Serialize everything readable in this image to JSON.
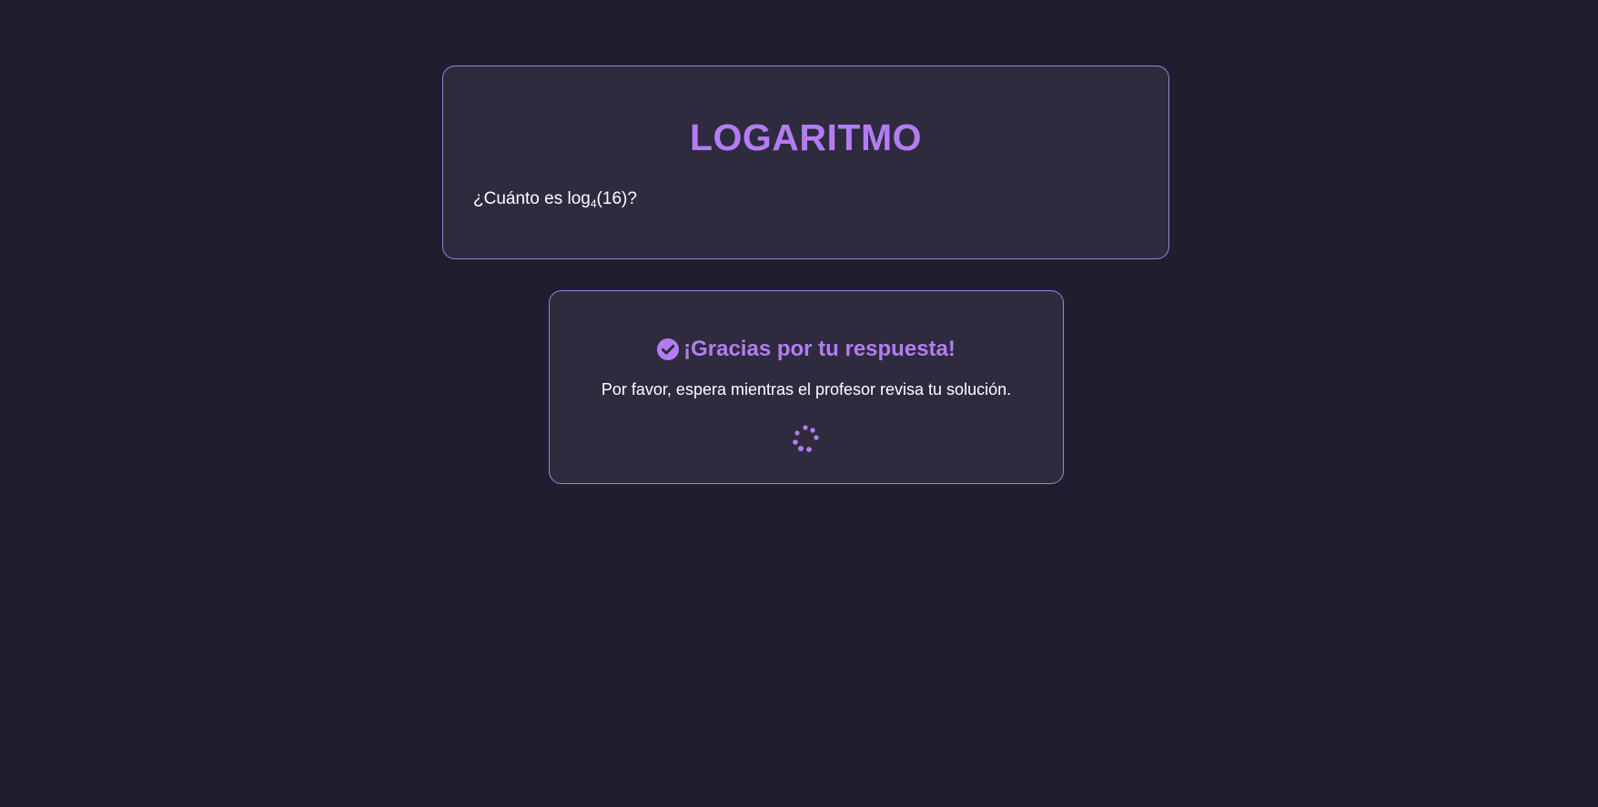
{
  "question": {
    "title": "LOGARITMO",
    "prompt_prefix": "¿Cuánto es log",
    "base": "4",
    "prompt_suffix": "(16)?"
  },
  "status": {
    "icon": "check-circle-icon",
    "title": "¡Gracias por tu respuesta!",
    "message": "Por favor, espera mientras el profesor revisa tu solución.",
    "loading_icon": "spinner-icon"
  },
  "colors": {
    "background": "#1f1e2e",
    "card": "#2d2b3d",
    "accent": "#b47cf2",
    "border": "#a07ee0",
    "text": "#ffffff"
  }
}
